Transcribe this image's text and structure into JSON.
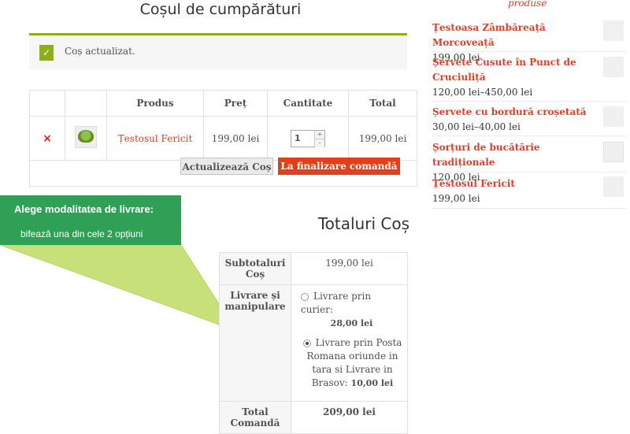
{
  "page_title": "Coșul de cumpărături",
  "notice": {
    "check_icon": "✓",
    "message": "Coș actualizat."
  },
  "cart": {
    "headers": {
      "product": "Produs",
      "price": "Preț",
      "quantity": "Cantitate",
      "total": "Total"
    },
    "rows": [
      {
        "remove": "×",
        "thumb_icon": "turtle-toy-icon",
        "name": "Țestosul Fericit",
        "price": "199,00 lei",
        "quantity": "1",
        "total": "199,00 lei"
      }
    ],
    "qty_up": "+",
    "qty_down": "-",
    "update_button": "Actualizează Coș",
    "checkout_button": "La finalizare comandă"
  },
  "callout": {
    "line1": "Alege modalitatea de livrare:",
    "line2": "bifează una din cele 2 opțiuni",
    "color": "#2fa056"
  },
  "totals": {
    "title": "Totaluri Coș",
    "subtotal_label": "Subtotaluri Coș",
    "subtotal_value": "199,00 lei",
    "shipping_label": "Livrare și manipulare",
    "shipping_options": [
      {
        "label": "Livrare prin curier:",
        "price": "28,00 lei",
        "selected": false
      },
      {
        "label": "Livrare prin Posta Romana oriunde in tara si Livrare in Brasov:",
        "price": "10,00 lei",
        "selected": true
      }
    ],
    "total_label": "Total Comandă",
    "total_value": "209,00 lei"
  },
  "sidebar": {
    "heading": "produse",
    "items": [
      {
        "name": "Țestoasa Zâmbăreață Morcoveață",
        "price": "199,00 lei",
        "icon": "turtle-carrot-icon"
      },
      {
        "name": "Șervete Cusute în Punct de Cruciuliță",
        "price": "120,00 lei–450,00 lei",
        "icon": "napkin-icon"
      },
      {
        "name": "Șervete cu bordură croșetată",
        "price": "30,00 lei–40,00 lei",
        "icon": "crochet-napkin-icon"
      },
      {
        "name": "Șorțuri de bucătărie tradiționale",
        "price": "120,00 lei",
        "icon": "apron-icon"
      },
      {
        "name": "Țestosul Fericit",
        "price": "199,00 lei",
        "icon": "turtle-toy-icon"
      }
    ]
  },
  "colors": {
    "accent": "#d9412a",
    "checkout": "#e1401a",
    "notice_bar": "#8fae1b"
  }
}
